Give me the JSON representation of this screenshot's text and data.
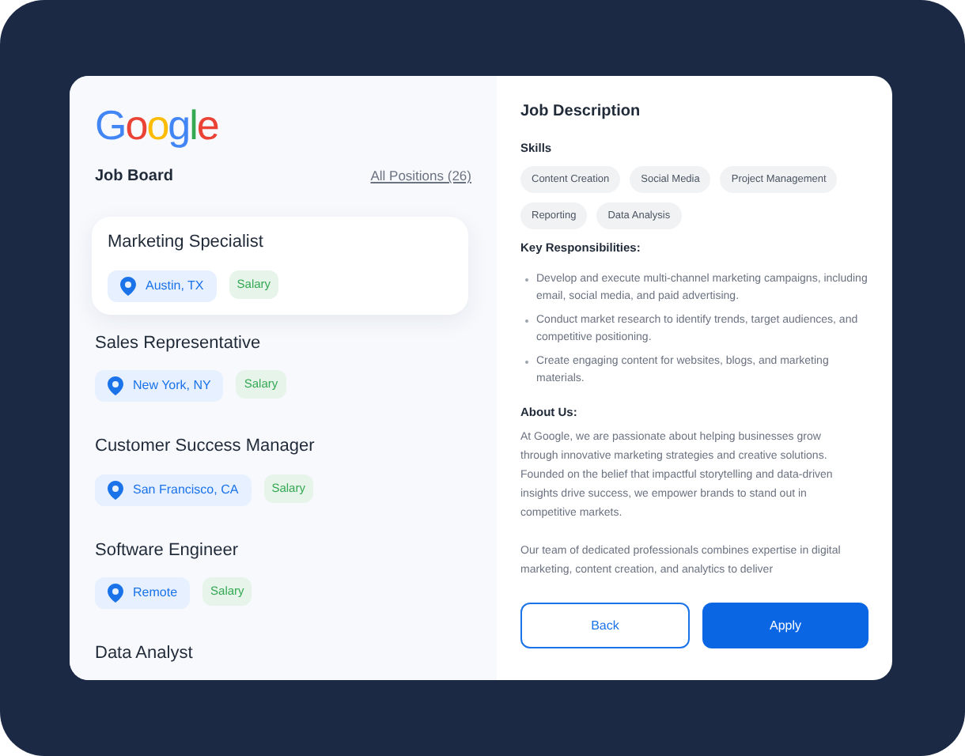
{
  "logo": "Google",
  "board": {
    "title": "Job Board",
    "link": "All Positions (26)"
  },
  "jobs": [
    {
      "title": "Marketing Specialist",
      "location": "Austin, TX",
      "salary": "Salary",
      "selected": true
    },
    {
      "title": "Sales Representative",
      "location": "New York, NY",
      "salary": "Salary",
      "selected": false
    },
    {
      "title": "Customer Success Manager",
      "location": "San Francisco, CA",
      "salary": "Salary",
      "selected": false
    },
    {
      "title": "Software Engineer",
      "location": "Remote",
      "salary": "Salary",
      "selected": false
    },
    {
      "title": "Data Analyst",
      "selected": false
    }
  ],
  "description": {
    "title": "Job Description",
    "skills_title": "Skills",
    "skills": [
      "Content Creation",
      "Social Media",
      "Project Management",
      "Reporting",
      "Data Analysis"
    ],
    "responsibilities_title": "Key Responsibilities:",
    "responsibilities": [
      "Develop and execute multi-channel marketing campaigns, including email, social media, and paid advertising.",
      "Conduct market research to identify trends, target audiences, and competitive positioning.",
      "Create engaging content for websites, blogs, and marketing materials."
    ],
    "about_title": "About Us:",
    "about": [
      "At Google, we are passionate about helping businesses grow through innovative marketing strategies and creative solutions. Founded on the belief that impactful storytelling and data-driven insights drive success, we empower brands to stand out in competitive markets.",
      "Our team of dedicated professionals combines expertise in digital marketing, content creation, and analytics to deliver"
    ]
  },
  "buttons": {
    "back": "Back",
    "apply": "Apply"
  }
}
